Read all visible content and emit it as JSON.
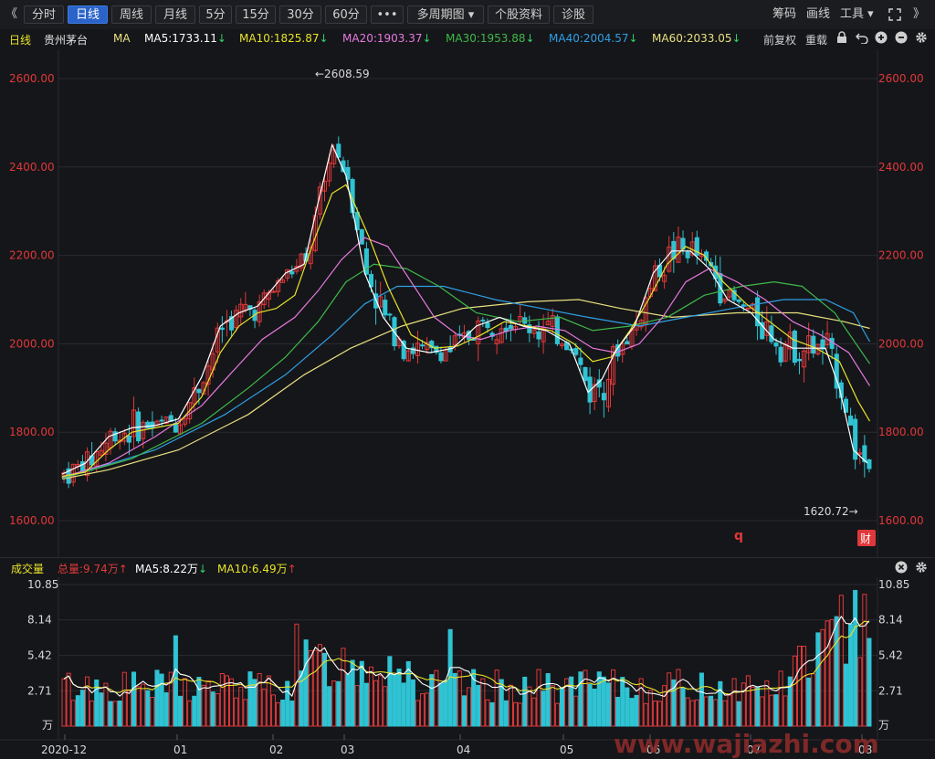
{
  "toolbar": {
    "collapse_left": "《",
    "tabs": [
      "分时",
      "日线",
      "周线",
      "月线",
      "5分",
      "15分",
      "30分",
      "60分",
      "•••",
      "多周期图 ▾",
      "个股资料",
      "诊股"
    ],
    "active_tab": "日线",
    "right_items": [
      "筹码",
      "画线",
      "工具 ▾"
    ],
    "fullscreen_icon": "fullscreen-icon",
    "expand_right": "》"
  },
  "info": {
    "period": "日线",
    "stock_name": "贵州茅台",
    "indicator": "MA",
    "ma5": "MA5:1733.11",
    "ma10": "MA10:1825.87",
    "ma20": "MA20:1903.37",
    "ma30": "MA30:1953.88",
    "ma40": "MA40:2004.57",
    "ma60": "MA60:2033.05",
    "down_arrow": "↓",
    "fuquan": "前复权",
    "reload": "重载"
  },
  "price_axis": [
    "2600.00",
    "2400.00",
    "2200.00",
    "2000.00",
    "1800.00",
    "1600.00"
  ],
  "annotations": {
    "high": "←2608.59",
    "low": "1620.72→"
  },
  "marks": {
    "q": "q",
    "cai": "财"
  },
  "volume_info": {
    "label": "成交量",
    "total": "总量:9.74万",
    "up_arrow": "↑",
    "vma5": "MA5:8.22万",
    "vma10": "MA10:6.49万",
    "down_arrow": "↓"
  },
  "volume_axis": [
    "10.85",
    "8.14",
    "5.42",
    "2.71",
    "万"
  ],
  "x_axis": [
    "2020-12",
    "01",
    "02",
    "03",
    "04",
    "05",
    "06",
    "07",
    "08"
  ],
  "watermark": "www.wajiazhi.com",
  "colors": {
    "up": "#e0383a",
    "down": "#2fc3d3",
    "ma5": "#ffffff",
    "ma10": "#e8e32a",
    "ma20": "#e779e0",
    "ma30": "#3fb84a",
    "ma40": "#2f9fe6",
    "ma60": "#e9e07f",
    "axis_red": "#e0383a"
  },
  "chart_data": {
    "type": "candlestick",
    "price_range": [
      1600,
      2630
    ],
    "volume_range": [
      0,
      10.85
    ],
    "series_points": {
      "ma5": [
        [
          0,
          1705
        ],
        [
          10,
          1730
        ],
        [
          20,
          1790
        ],
        [
          30,
          1810
        ],
        [
          40,
          1815
        ],
        [
          50,
          1830
        ],
        [
          60,
          1925
        ],
        [
          68,
          2040
        ],
        [
          76,
          2070
        ],
        [
          84,
          2085
        ],
        [
          88,
          2110
        ],
        [
          96,
          2160
        ],
        [
          104,
          2180
        ],
        [
          110,
          2320
        ],
        [
          116,
          2450
        ],
        [
          122,
          2380
        ],
        [
          130,
          2160
        ],
        [
          138,
          2060
        ],
        [
          148,
          1990
        ],
        [
          158,
          1980
        ],
        [
          168,
          1990
        ],
        [
          178,
          2040
        ],
        [
          188,
          2060
        ],
        [
          198,
          2040
        ],
        [
          208,
          2030
        ],
        [
          218,
          2000
        ],
        [
          226,
          1890
        ],
        [
          232,
          1920
        ],
        [
          238,
          1985
        ],
        [
          246,
          2040
        ],
        [
          254,
          2160
        ],
        [
          262,
          2210
        ],
        [
          270,
          2210
        ],
        [
          278,
          2170
        ],
        [
          286,
          2100
        ],
        [
          296,
          2070
        ],
        [
          306,
          2010
        ],
        [
          314,
          1990
        ],
        [
          322,
          1990
        ],
        [
          328,
          1990
        ],
        [
          334,
          1900
        ],
        [
          340,
          1760
        ],
        [
          346,
          1730
        ]
      ],
      "ma10": [
        [
          0,
          1700
        ],
        [
          10,
          1710
        ],
        [
          20,
          1760
        ],
        [
          30,
          1800
        ],
        [
          40,
          1810
        ],
        [
          50,
          1820
        ],
        [
          60,
          1880
        ],
        [
          68,
          1980
        ],
        [
          76,
          2040
        ],
        [
          84,
          2070
        ],
        [
          92,
          2080
        ],
        [
          100,
          2110
        ],
        [
          108,
          2230
        ],
        [
          116,
          2340
        ],
        [
          122,
          2360
        ],
        [
          132,
          2240
        ],
        [
          140,
          2130
        ],
        [
          150,
          2020
        ],
        [
          160,
          1990
        ],
        [
          170,
          1995
        ],
        [
          180,
          2020
        ],
        [
          190,
          2050
        ],
        [
          200,
          2040
        ],
        [
          210,
          2030
        ],
        [
          220,
          2000
        ],
        [
          228,
          1960
        ],
        [
          236,
          1970
        ],
        [
          244,
          2030
        ],
        [
          252,
          2100
        ],
        [
          260,
          2180
        ],
        [
          268,
          2220
        ],
        [
          276,
          2200
        ],
        [
          284,
          2140
        ],
        [
          294,
          2090
        ],
        [
          304,
          2050
        ],
        [
          314,
          2010
        ],
        [
          324,
          1990
        ],
        [
          334,
          1960
        ],
        [
          342,
          1870
        ],
        [
          347,
          1825
        ]
      ],
      "ma20": [
        [
          0,
          1698
        ],
        [
          20,
          1730
        ],
        [
          40,
          1790
        ],
        [
          60,
          1860
        ],
        [
          72,
          1930
        ],
        [
          86,
          2010
        ],
        [
          100,
          2060
        ],
        [
          110,
          2120
        ],
        [
          120,
          2190
        ],
        [
          130,
          2240
        ],
        [
          140,
          2220
        ],
        [
          150,
          2140
        ],
        [
          160,
          2060
        ],
        [
          170,
          2020
        ],
        [
          180,
          2010
        ],
        [
          192,
          2030
        ],
        [
          204,
          2040
        ],
        [
          216,
          2030
        ],
        [
          228,
          1990
        ],
        [
          238,
          1980
        ],
        [
          248,
          2000
        ],
        [
          258,
          2060
        ],
        [
          268,
          2140
        ],
        [
          278,
          2170
        ],
        [
          290,
          2140
        ],
        [
          302,
          2100
        ],
        [
          314,
          2050
        ],
        [
          326,
          2020
        ],
        [
          338,
          1980
        ],
        [
          347,
          1905
        ]
      ],
      "ma30": [
        [
          0,
          1696
        ],
        [
          30,
          1740
        ],
        [
          60,
          1820
        ],
        [
          80,
          1900
        ],
        [
          96,
          1970
        ],
        [
          110,
          2050
        ],
        [
          122,
          2140
        ],
        [
          134,
          2180
        ],
        [
          148,
          2170
        ],
        [
          162,
          2130
        ],
        [
          178,
          2070
        ],
        [
          196,
          2050
        ],
        [
          214,
          2060
        ],
        [
          228,
          2030
        ],
        [
          244,
          2040
        ],
        [
          260,
          2060
        ],
        [
          276,
          2110
        ],
        [
          292,
          2130
        ],
        [
          306,
          2140
        ],
        [
          318,
          2130
        ],
        [
          332,
          2070
        ],
        [
          347,
          1955
        ]
      ],
      "ma40": [
        [
          0,
          1695
        ],
        [
          40,
          1760
        ],
        [
          70,
          1840
        ],
        [
          96,
          1930
        ],
        [
          116,
          2020
        ],
        [
          130,
          2090
        ],
        [
          144,
          2130
        ],
        [
          164,
          2130
        ],
        [
          186,
          2100
        ],
        [
          206,
          2080
        ],
        [
          226,
          2060
        ],
        [
          248,
          2040
        ],
        [
          268,
          2060
        ],
        [
          288,
          2080
        ],
        [
          310,
          2100
        ],
        [
          328,
          2100
        ],
        [
          340,
          2070
        ],
        [
          347,
          2005
        ]
      ],
      "ma60": [
        [
          0,
          1694
        ],
        [
          20,
          1715
        ],
        [
          50,
          1760
        ],
        [
          80,
          1840
        ],
        [
          104,
          1930
        ],
        [
          124,
          1990
        ],
        [
          146,
          2040
        ],
        [
          172,
          2080
        ],
        [
          200,
          2095
        ],
        [
          222,
          2100
        ],
        [
          240,
          2080
        ],
        [
          262,
          2060
        ],
        [
          290,
          2070
        ],
        [
          316,
          2070
        ],
        [
          336,
          2050
        ],
        [
          347,
          2035
        ]
      ]
    }
  }
}
